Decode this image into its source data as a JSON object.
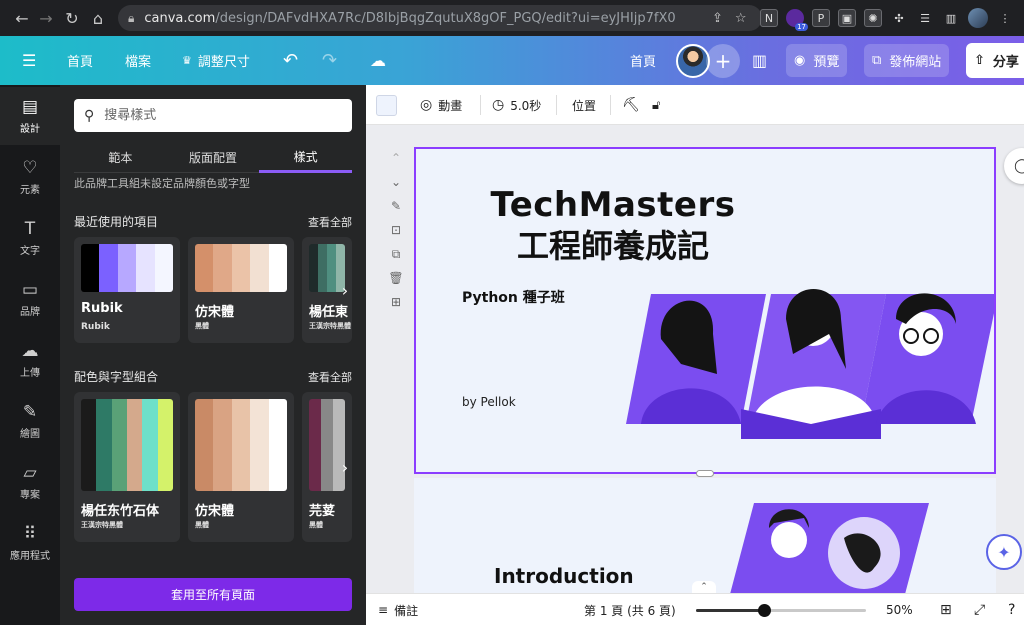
{
  "browser": {
    "url_host": "canva.com",
    "url_path": "/design/DAFvdHXA7Rc/D8IbjBqgZqutuX8gOF_PGQ/edit?ui=eyJHIjp7fX0",
    "ext_badge": "17",
    "ext_letter_p": "P"
  },
  "topbar": {
    "home": "首頁",
    "file": "檔案",
    "resize": "調整尺寸",
    "home_right": "首頁",
    "preview": "預覽",
    "publish": "發佈網站",
    "share": "分享"
  },
  "rail": [
    {
      "label": "設計",
      "icon": "design-icon"
    },
    {
      "label": "元素",
      "icon": "elements-icon"
    },
    {
      "label": "文字",
      "icon": "text-icon"
    },
    {
      "label": "品牌",
      "icon": "brand-icon"
    },
    {
      "label": "上傳",
      "icon": "upload-icon"
    },
    {
      "label": "繪圖",
      "icon": "draw-icon"
    },
    {
      "label": "專案",
      "icon": "folder-icon"
    },
    {
      "label": "應用程式",
      "icon": "apps-icon"
    }
  ],
  "panel": {
    "search_placeholder": "搜尋樣式",
    "tabs": [
      "範本",
      "版面配置",
      "樣式"
    ],
    "hint": "此品牌工具組未設定品牌顏色或字型",
    "recent_title": "最近使用的項目",
    "see_all": "查看全部",
    "combo_title": "配色與字型組合",
    "apply_all": "套用至所有頁面",
    "recent": [
      {
        "font1": "Rubik",
        "font2": "Rubik",
        "colors": [
          "#000000",
          "#7b61ff",
          "#b7a8ff",
          "#e6e3ff",
          "#f4f6ff"
        ]
      },
      {
        "font1": "仿宋體",
        "font2": "黑體",
        "colors": [
          "#d4906a",
          "#e0a888",
          "#ebc3a8",
          "#f2e0d2",
          "#ffffff"
        ]
      },
      {
        "font1": "楊任東",
        "font2": "王漢宗特黑體",
        "colors": [
          "#1f2a2a",
          "#3e6e63",
          "#4f8f80",
          "#8fb5a8"
        ]
      }
    ],
    "combos": [
      {
        "font1": "楊任东竹石体",
        "font2": "王漢宗特黑體",
        "colors": [
          "#1b1b1b",
          "#2e7a66",
          "#5aa177",
          "#d4a98c",
          "#6ee0c9",
          "#d4f26a"
        ]
      },
      {
        "font1": "仿宋體",
        "font2": "黑體",
        "colors": [
          "#c98a66",
          "#d9a383",
          "#e8c3a8",
          "#f3e3d6",
          "#ffffff"
        ]
      },
      {
        "font1": "芫荽",
        "font2": "黑體",
        "colors": [
          "#6b2a4a",
          "#888888",
          "#b9b9b9"
        ]
      }
    ]
  },
  "toolbar2": {
    "animate": "動畫",
    "duration": "5.0秒",
    "position": "位置"
  },
  "slide1": {
    "title_en": "TechMasters",
    "title_zh": "工程師養成記",
    "subtitle": "Python 種子班",
    "author": "by Pellok"
  },
  "slide2": {
    "title": "Introduction"
  },
  "bottombar": {
    "notes": "備註",
    "page": "第 1 頁 (共 6 頁)",
    "zoom": "50%",
    "zoom_fraction": 0.4
  },
  "colors": {
    "accent": "#8b3dff",
    "apply_button": "#7d2ae8",
    "illustration": "#7b4df0"
  }
}
